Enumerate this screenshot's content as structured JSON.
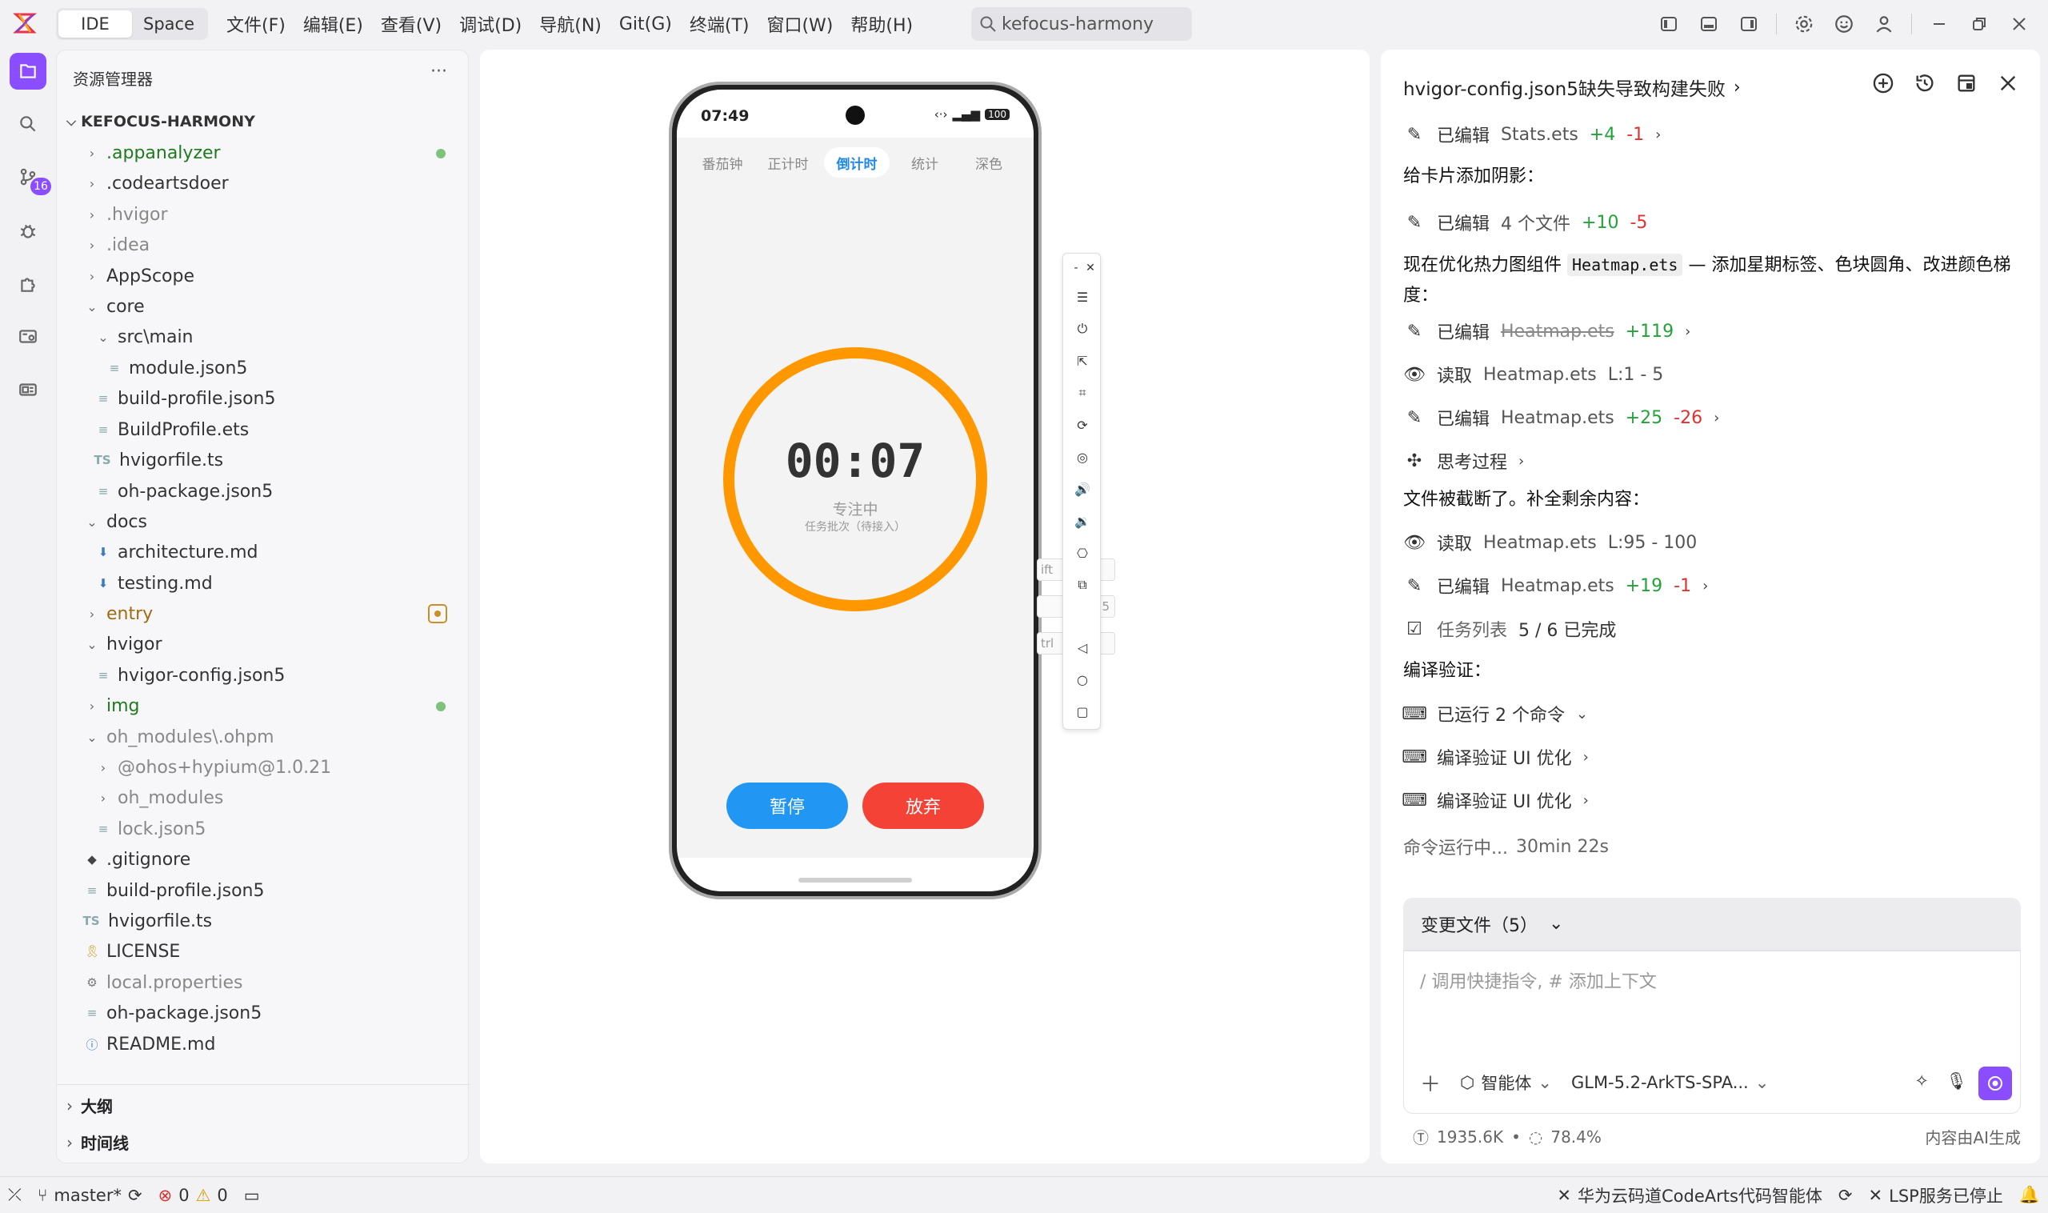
{
  "titlebar": {
    "modes": [
      "IDE",
      "Space"
    ],
    "menu": [
      "文件(F)",
      "编辑(E)",
      "查看(V)",
      "调试(D)",
      "导航(N)",
      "Git(G)",
      "终端(T)",
      "窗口(W)",
      "帮助(H)"
    ],
    "search_value": "kefocus-harmony"
  },
  "activity": {
    "badge": "16"
  },
  "explorer": {
    "header": "资源管理器",
    "more": "···",
    "project": "KEFOCUS-HARMONY",
    "items": [
      {
        "label": ".appanalyzer"
      },
      {
        "label": ".codeartsdoer"
      },
      {
        "label": ".hvigor"
      },
      {
        "label": ".idea"
      },
      {
        "label": "AppScope"
      },
      {
        "label": "core"
      },
      {
        "label": "src\\main"
      },
      {
        "label": "module.json5"
      },
      {
        "label": "build-profile.json5"
      },
      {
        "label": "BuildProfile.ets"
      },
      {
        "label": "hvigorfile.ts"
      },
      {
        "label": "oh-package.json5"
      },
      {
        "label": "docs"
      },
      {
        "label": "architecture.md"
      },
      {
        "label": "testing.md"
      },
      {
        "label": "entry"
      },
      {
        "label": "hvigor"
      },
      {
        "label": "hvigor-config.json5"
      },
      {
        "label": "img"
      },
      {
        "label": "oh_modules\\.ohpm"
      },
      {
        "label": "@ohos+hypium@1.0.21"
      },
      {
        "label": "oh_modules"
      },
      {
        "label": "lock.json5"
      },
      {
        "label": ".gitignore"
      },
      {
        "label": "build-profile.json5"
      },
      {
        "label": "hvigorfile.ts"
      },
      {
        "label": "LICENSE"
      },
      {
        "label": "local.properties"
      },
      {
        "label": "oh-package.json5"
      },
      {
        "label": "README.md"
      }
    ],
    "ts_tag": "TS",
    "outline": "大纲",
    "timeline": "时间线"
  },
  "phone": {
    "time": "07:49",
    "battery": "100",
    "tabs": [
      "番茄钟",
      "正计时",
      "倒计时",
      "统计",
      "深色"
    ],
    "timer": "00:07",
    "status": "专注中",
    "sub": "任务批次（待接入）",
    "pause": "暂停",
    "abandon": "放弃",
    "progress_fraction": 1.0,
    "ring_color": "#ff9800",
    "hints": [
      "ift",
      "5",
      "trl"
    ]
  },
  "ai": {
    "title": "hvigor-config.json5缺失导致构建失败",
    "edited": "已编辑",
    "read": "读取",
    "lines": {
      "l1_file": "Stats.ets",
      "l1_plus": "+4",
      "l1_minus": "-1",
      "t1": "给卡片添加阴影：",
      "l2_file": "4 个文件",
      "l2_plus": "+10",
      "l2_minus": "-5",
      "t2_pre": "现在优化热力图组件 ",
      "t2_code": "Heatmap.ets",
      "t2_post": " — 添加星期标签、色块圆角、改进颜色梯度：",
      "l3_file": "Heatmap.ets",
      "l3_plus": "+119",
      "l4_file": "Heatmap.ets",
      "l4_range": "L:1 - 5",
      "l5_file": "Heatmap.ets",
      "l5_plus": "+25",
      "l5_minus": "-26",
      "think": "思考过程",
      "t3": "文件被截断了。补全剩余内容：",
      "l6_file": "Heatmap.ets",
      "l6_range": "L:95 - 100",
      "l7_file": "Heatmap.ets",
      "l7_plus": "+19",
      "l7_minus": "-1",
      "task_label": "任务列表",
      "task_value": "5 / 6 已完成",
      "t4": "编译验证：",
      "cmd1": "已运行 2 个命令",
      "cmd2": "编译验证 UI 优化",
      "cmd3": "编译验证 UI 优化",
      "running": "命令运行中...",
      "running_time": "30min 22s"
    },
    "changes": "变更文件（5）",
    "placeholder": "/ 调用快捷指令, # 添加上下文",
    "agent": "智能体",
    "model": "GLM-5.2-ArkTS-SPA...",
    "tokens": "1935.6K",
    "bullet": "•",
    "usage": "78.4%",
    "ai_note": "内容由AI生成"
  },
  "statusbar": {
    "branch": "master*",
    "errors": "0",
    "warnings": "0",
    "assistant": "华为云码道CodeArts代码智能体",
    "lsp": "LSP服务已停止"
  },
  "colors": {
    "accent": "#8a4dff",
    "blue": "#2196f3",
    "red": "#f44336",
    "orange": "#ff9800"
  }
}
